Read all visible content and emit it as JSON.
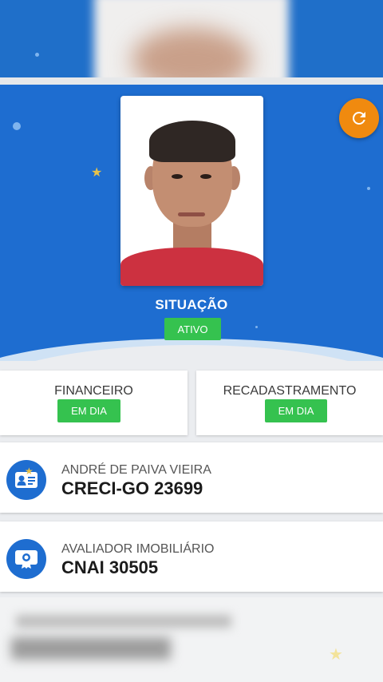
{
  "hero": {
    "situacao_label": "SITUAÇÃO",
    "status_badge": "ATIVO",
    "refresh_icon": "refresh-icon"
  },
  "status_cards": [
    {
      "title": "FINANCEIRO",
      "badge": "EM DIA"
    },
    {
      "title": "RECADASTRAMENTO",
      "badge": "EM DIA"
    }
  ],
  "info_cards": [
    {
      "subtitle": "ANDRÉ DE PAIVA VIEIRA",
      "value": "CRECI-GO 23699",
      "icon": "id-card-icon"
    },
    {
      "subtitle": "AVALIADOR IMOBILIÁRIO",
      "value": "CNAI 30505",
      "icon": "certificate-icon"
    }
  ],
  "colors": {
    "primary_blue": "#1e6dd0",
    "badge_green": "#35c24f",
    "refresh_orange": "#f08a0f"
  }
}
